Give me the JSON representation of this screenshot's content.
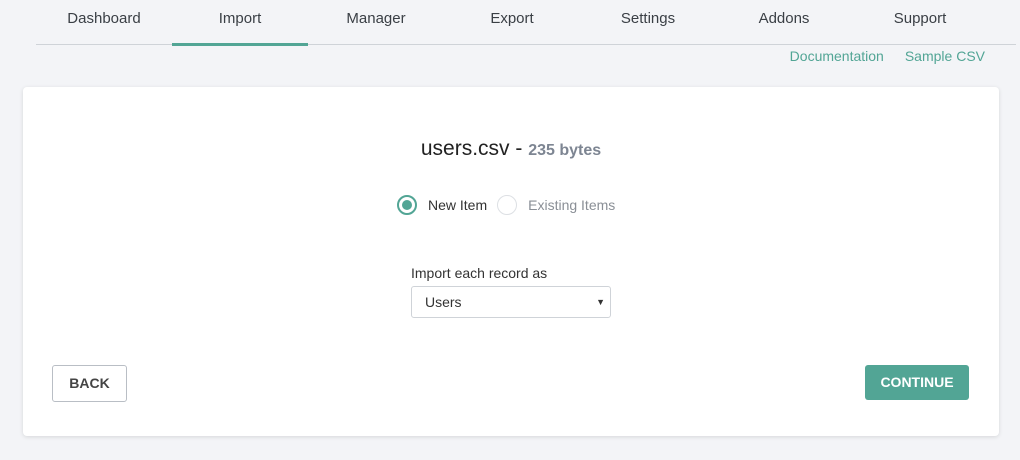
{
  "tabs": [
    {
      "label": "Dashboard",
      "active": false
    },
    {
      "label": "Import",
      "active": true
    },
    {
      "label": "Manager",
      "active": false
    },
    {
      "label": "Export",
      "active": false
    },
    {
      "label": "Settings",
      "active": false
    },
    {
      "label": "Addons",
      "active": false
    },
    {
      "label": "Support",
      "active": false
    }
  ],
  "links": {
    "documentation": "Documentation",
    "sample_csv": "Sample CSV"
  },
  "file": {
    "name": "users.csv",
    "separator": "-",
    "size": "235 bytes"
  },
  "radio": {
    "new_item": "New Item",
    "existing_items": "Existing Items",
    "selected": "new_item"
  },
  "import_as": {
    "label": "Import each record as",
    "value": "Users"
  },
  "buttons": {
    "back": "BACK",
    "continue": "CONTINUE"
  },
  "colors": {
    "accent": "#52a595",
    "background": "#f3f4f7"
  }
}
